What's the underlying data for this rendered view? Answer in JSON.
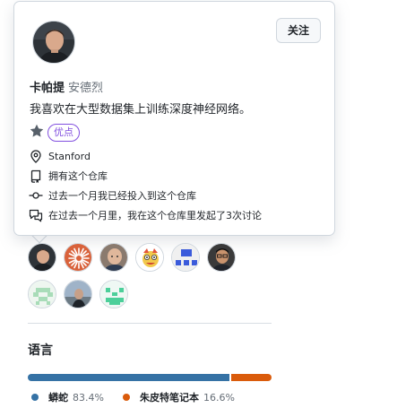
{
  "hovercard": {
    "name": "卡帕提",
    "login": "安德烈",
    "bio": "我喜欢在大型数据集上训练深度神经网络。",
    "follow_label": "关注",
    "badge": "优点",
    "location": "Stanford",
    "details": [
      "拥有这个仓库",
      "过去一个月我已经投入到这个仓库",
      "在过去一个月里，我在这个仓库里发起了3次讨论"
    ]
  },
  "contributors": [
    {
      "icon": "avatar-photo-man-dark"
    },
    {
      "icon": "avatar-orange-starburst"
    },
    {
      "icon": "avatar-photo-man-bald"
    },
    {
      "icon": "avatar-cartoon"
    },
    {
      "icon": "avatar-identicon-blue"
    },
    {
      "icon": "avatar-photo-man-glasses"
    },
    {
      "icon": "avatar-identicon-green"
    },
    {
      "icon": "avatar-photo-person-outdoor"
    },
    {
      "icon": "avatar-identicon-teal"
    }
  ],
  "languages": {
    "title": "语言",
    "items": [
      {
        "name": "蟒蛇",
        "percent": "83.4%",
        "value": 83.4,
        "color": "#3572A5"
      },
      {
        "name": "朱皮特笔记本",
        "percent": "16.6%",
        "value": 16.6,
        "color": "#DA5B0B"
      }
    ]
  },
  "colors": {
    "badge_purple": "#8250df",
    "border": "#d0d7de"
  }
}
